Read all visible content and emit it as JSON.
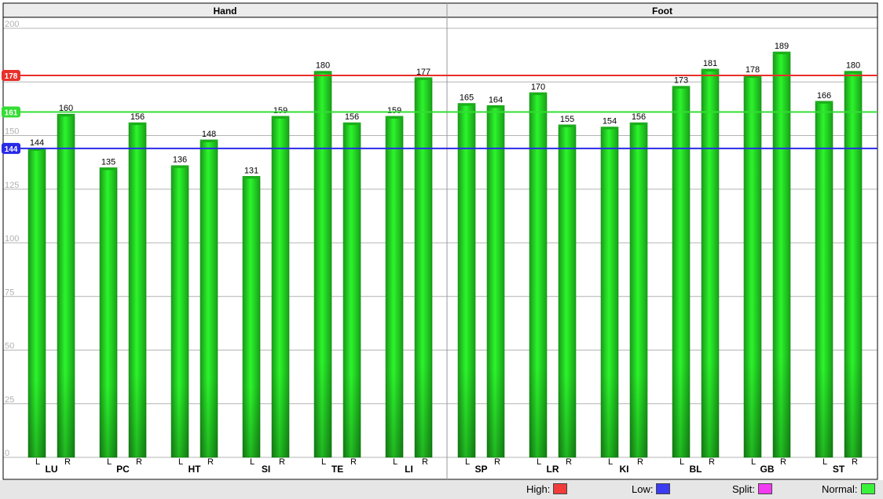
{
  "chart_data": {
    "type": "bar",
    "ylim": [
      0,
      200
    ],
    "yticks": [
      0,
      25,
      50,
      75,
      100,
      125,
      150,
      175,
      200
    ],
    "panels": [
      {
        "title": "Hand",
        "meridians": [
          {
            "name": "LU",
            "L": 144,
            "R": 160
          },
          {
            "name": "PC",
            "L": 135,
            "R": 156
          },
          {
            "name": "HT",
            "L": 136,
            "R": 148
          },
          {
            "name": "SI",
            "L": 131,
            "R": 159
          },
          {
            "name": "TE",
            "L": 180,
            "R": 156
          },
          {
            "name": "LI",
            "L": 159,
            "R": 177
          }
        ]
      },
      {
        "title": "Foot",
        "meridians": [
          {
            "name": "SP",
            "L": 165,
            "R": 164
          },
          {
            "name": "LR",
            "L": 170,
            "R": 155
          },
          {
            "name": "KI",
            "L": 154,
            "R": 156
          },
          {
            "name": "BL",
            "L": 173,
            "R": 181
          },
          {
            "name": "GB",
            "L": 178,
            "R": 189
          },
          {
            "name": "ST",
            "L": 166,
            "R": 180
          }
        ]
      }
    ],
    "side_labels": {
      "left": "L",
      "right": "R"
    },
    "reference_lines": [
      {
        "name": "high",
        "value": 178,
        "label": "178",
        "color": "#e8302a"
      },
      {
        "name": "normal",
        "value": 161,
        "label": "161",
        "color": "#33dd33"
      },
      {
        "name": "low",
        "value": 144,
        "label": "144",
        "color": "#2a2ae8"
      }
    ],
    "bar_color": "#22ee22",
    "grid": true
  },
  "legend": [
    {
      "label": "High:",
      "color": "#f23b3b"
    },
    {
      "label": "Low:",
      "color": "#3b3bf2"
    },
    {
      "label": "Split:",
      "color": "#f23bf2"
    },
    {
      "label": "Normal:",
      "color": "#3bf23b"
    }
  ]
}
